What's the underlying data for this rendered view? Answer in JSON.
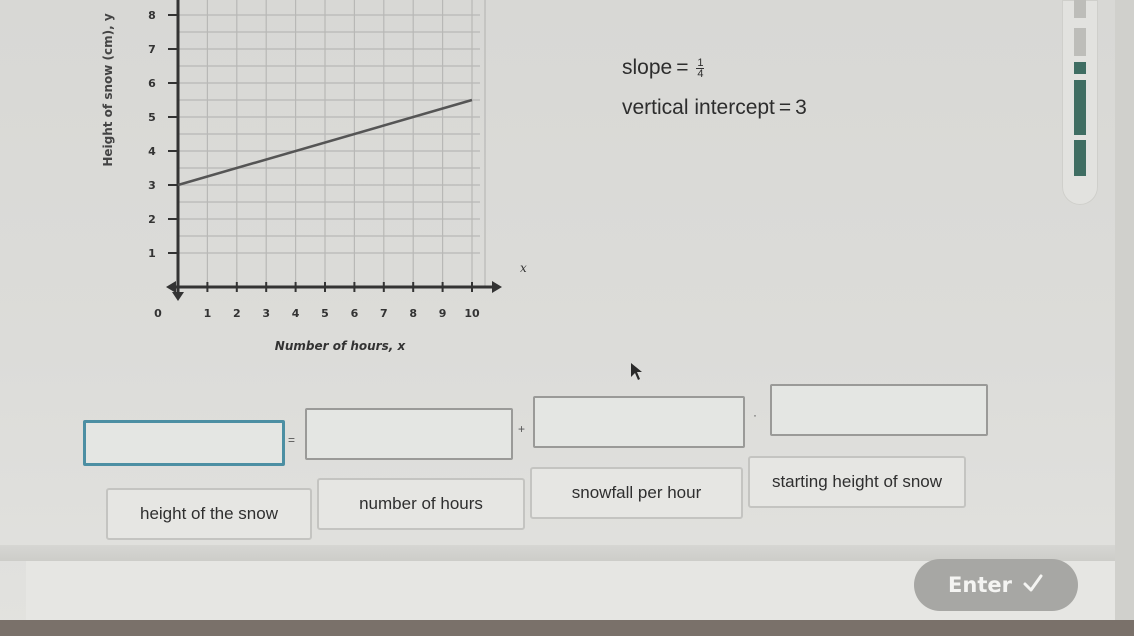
{
  "chart_data": {
    "type": "line",
    "title": "",
    "xlabel": "Number of hours, x",
    "ylabel": "Height of snow (cm), y",
    "x_ticks": [
      "0",
      "1",
      "2",
      "3",
      "4",
      "5",
      "6",
      "7",
      "8",
      "9",
      "10"
    ],
    "y_ticks": [
      "1",
      "2",
      "3",
      "4",
      "5",
      "6",
      "7",
      "8"
    ],
    "x_axis_arrow_label": "x",
    "xlim": [
      0,
      10
    ],
    "ylim": [
      0,
      8
    ],
    "grid": true,
    "series": [
      {
        "name": "snow height",
        "x": [
          0,
          10
        ],
        "y": [
          3,
          5.5
        ]
      }
    ]
  },
  "given": {
    "slope_label": "slope",
    "equals": "=",
    "slope_numerator": "1",
    "slope_denominator": "4",
    "intercept_label": "vertical intercept",
    "intercept_value": "3"
  },
  "equation": {
    "operators": [
      "=",
      "+",
      "·"
    ]
  },
  "tiles": [
    "height of the snow",
    "number of hours",
    "snowfall per hour",
    "starting height of snow"
  ],
  "progress": {
    "completed_segments": 3,
    "total_segments": 5
  },
  "footer": {
    "enter_label": "Enter",
    "enter_icon": "checkmark-icon"
  }
}
